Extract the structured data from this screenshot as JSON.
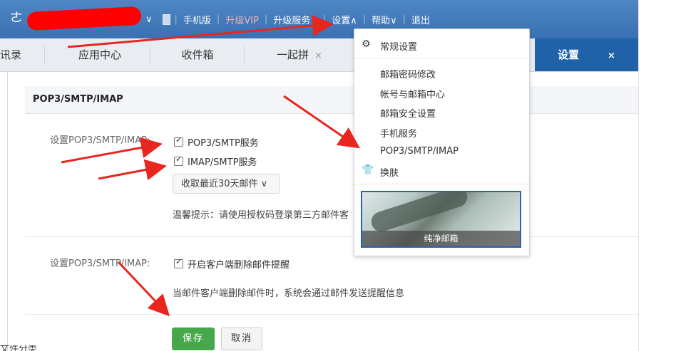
{
  "topbar": {
    "nav": [
      "手机版",
      "升级VIP",
      "升级服务",
      "设置",
      "帮助",
      "退出"
    ],
    "chevron": "∨",
    "chevron_up": "∧"
  },
  "tabs": {
    "items": [
      "讯录",
      "应用中心",
      "收件箱",
      "一起拼",
      "设置"
    ],
    "close": "×"
  },
  "panel": {
    "title": "POP3/SMTP/IMAP",
    "row1_label": "设置POP3/SMTP/IMAP:",
    "pop3": "POP3/SMTP服务",
    "imap": "IMAP/SMTP服务",
    "fetch": "收取最近30天邮件",
    "tip": "温馨提示：请使用授权码登录第三方邮件客",
    "row2_label": "设置POP3/SMTP/IMAP:",
    "delete_alert": "开启客户端删除邮件提醒",
    "delete_desc": "当邮件客户端删除邮件时，系统会通过邮件发送提醒信息",
    "save": "保存",
    "cancel": "取消",
    "bottom_cut": "文件分类"
  },
  "dropdown": {
    "general": "常规设置",
    "items": [
      "邮箱密码修改",
      "帐号与邮箱中心",
      "邮箱安全设置",
      "手机服务",
      "POP3/SMTP/IMAP"
    ],
    "skin": "换肤",
    "skin_caption": "纯净邮箱"
  },
  "colors": {
    "topbar": "#3a71b3",
    "active_tab": "#1f62a7",
    "save": "#46a84b",
    "arrow": "#e8261f"
  }
}
